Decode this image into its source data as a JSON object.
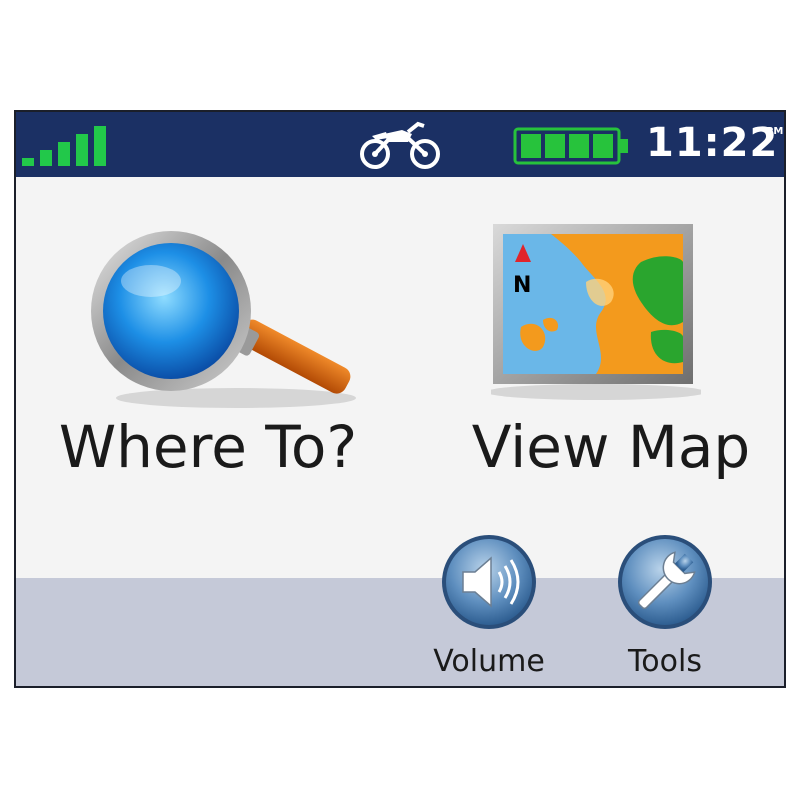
{
  "status_bar": {
    "time": "11:22",
    "meridiem": "PM",
    "signal_bars": 5,
    "battery_level": 1.0,
    "vehicle_icon": "motorcycle-icon",
    "colors": {
      "bar": "#1b3064",
      "signal": "#22c84a",
      "battery": "#27c33c"
    }
  },
  "main": {
    "tiles": [
      {
        "label": "Where To?",
        "icon": "magnifying-glass-icon"
      },
      {
        "label": "View Map",
        "icon": "map-icon"
      }
    ]
  },
  "bottom": {
    "buttons": [
      {
        "label": "Volume",
        "icon": "speaker-icon"
      },
      {
        "label": "Tools",
        "icon": "wrench-icon"
      }
    ]
  }
}
